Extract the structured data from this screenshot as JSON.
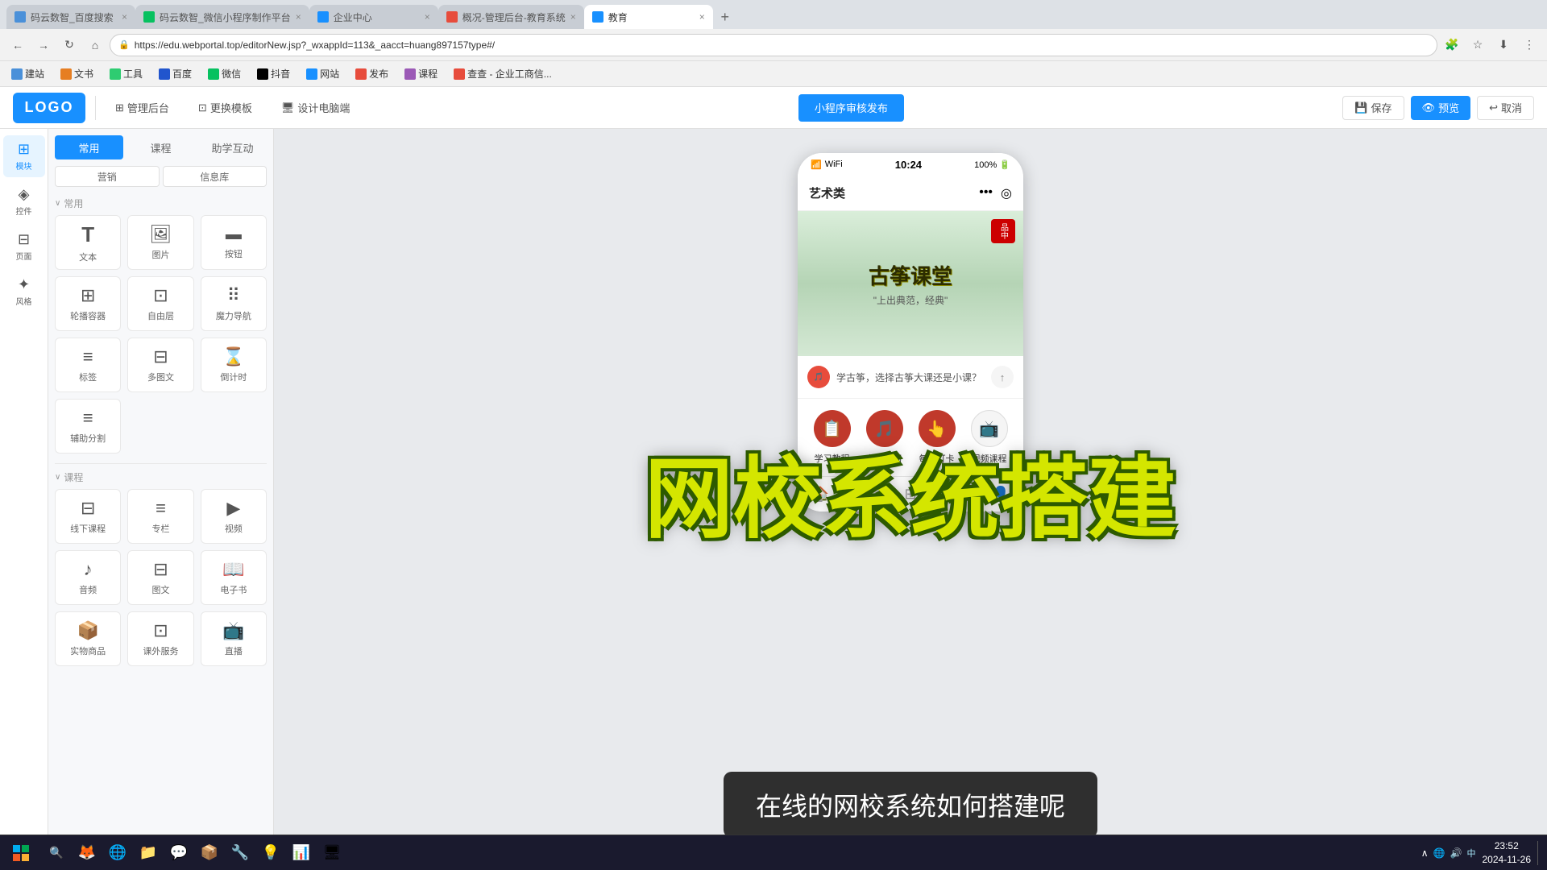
{
  "browser": {
    "tabs": [
      {
        "id": "t1",
        "label": "码云数智_百度搜索",
        "active": false,
        "favicon_color": "#4a90d9"
      },
      {
        "id": "t2",
        "label": "码云数智_微信小程序制作平台",
        "active": false,
        "favicon_color": "#07c160"
      },
      {
        "id": "t3",
        "label": "企业中心",
        "active": false,
        "favicon_color": "#1890ff"
      },
      {
        "id": "t4",
        "label": "概况-管理后台-教育系统",
        "active": false,
        "favicon_color": "#e74c3c"
      },
      {
        "id": "t5",
        "label": "教育",
        "active": true,
        "favicon_color": "#1890ff"
      }
    ],
    "address": "https://edu.webportal.top/editorNew.jsp?_wxappId=113&_aacct=huang897157type#/"
  },
  "bookmarks": [
    {
      "label": "建站",
      "icon_color": "#4a90d9"
    },
    {
      "label": "文书",
      "icon_color": "#e67e22"
    },
    {
      "label": "工具",
      "icon_color": "#2ecc71"
    },
    {
      "label": "百度",
      "icon_color": "#2155cd"
    },
    {
      "label": "微信",
      "icon_color": "#07c160"
    },
    {
      "label": "抖音",
      "icon_color": "#000"
    },
    {
      "label": "网站",
      "icon_color": "#1890ff"
    },
    {
      "label": "发布",
      "icon_color": "#e74c3c"
    },
    {
      "label": "课程",
      "icon_color": "#9b59b6"
    },
    {
      "label": "查查 - 企业工商信...",
      "icon_color": "#e74c3c"
    }
  ],
  "toolbar": {
    "logo": "LOGO",
    "management_label": "管理后台",
    "template_label": "更换模板",
    "design_label": "设计电脑端",
    "publish_label": "小程序审核发布",
    "save_label": "保存",
    "preview_label": "预览",
    "cancel_label": "取消"
  },
  "sidebar": {
    "items": [
      {
        "label": "模块",
        "icon": "⊞",
        "active": true
      },
      {
        "label": "控件",
        "icon": "◈",
        "active": false
      },
      {
        "label": "页面",
        "icon": "⊟",
        "active": false
      },
      {
        "label": "风格",
        "icon": "✦",
        "active": false
      }
    ]
  },
  "panel": {
    "tabs": [
      {
        "label": "常用",
        "active": true
      },
      {
        "label": "课程",
        "active": false
      },
      {
        "label": "助学互动",
        "active": false
      }
    ],
    "subtabs": [
      {
        "label": "营销",
        "active": false
      },
      {
        "label": "信息库",
        "active": false
      }
    ],
    "sections": [
      {
        "title": "常用",
        "items": [
          {
            "label": "文本",
            "icon": "T"
          },
          {
            "label": "图片",
            "icon": "🖼"
          },
          {
            "label": "按钮",
            "icon": "▬"
          },
          {
            "label": "轮播容器",
            "icon": "⊞"
          },
          {
            "label": "自由层",
            "icon": "⊡"
          },
          {
            "label": "魔力导航",
            "icon": "⠿"
          },
          {
            "label": "标签",
            "icon": "≡"
          },
          {
            "label": "多图文",
            "icon": "⊟"
          },
          {
            "label": "倒计时",
            "icon": "⌛"
          },
          {
            "label": "辅助分割",
            "icon": "≡"
          }
        ]
      },
      {
        "title": "课程",
        "items": [
          {
            "label": "线下课程",
            "icon": "⊟"
          },
          {
            "label": "专栏",
            "icon": "≡"
          },
          {
            "label": "视频",
            "icon": "▶"
          },
          {
            "label": "音频",
            "icon": "♪"
          },
          {
            "label": "图文",
            "icon": "⊟"
          },
          {
            "label": "电子书",
            "icon": "📖"
          },
          {
            "label": "实物商品",
            "icon": "📦"
          },
          {
            "label": "课外服务",
            "icon": "⊡"
          },
          {
            "label": "直播",
            "icon": "📺"
          }
        ]
      }
    ]
  },
  "phone": {
    "status_left": "📶 WiFi",
    "time": "10:24",
    "battery": "100% 🔋",
    "title": "艺术类",
    "banner_title": "古筝课堂",
    "banner_subtitle": "\"上出典范，经典\"",
    "seal_text": "品\n中",
    "chat_text": "学古筝，选择古筝大课还是小课？",
    "menu_items": [
      {
        "label": "学习教程",
        "icon": "📋",
        "color": "#c0392b"
      },
      {
        "label": "曲谱练习",
        "icon": "🎵",
        "color": "#c0392b"
      },
      {
        "label": "每日打卡",
        "icon": "👆",
        "color": "#c0392b"
      },
      {
        "label": "视频课程",
        "icon": "📺",
        "color": "#c0392b"
      }
    ],
    "bottom_nav": [
      {
        "label": "🏠",
        "active": true
      },
      {
        "label": "👤",
        "active": false
      },
      {
        "label": "⊞",
        "active": false
      },
      {
        "label": "📅",
        "active": false
      },
      {
        "label": "👤",
        "active": false
      }
    ]
  },
  "overlay": {
    "big_text": "网校系统搭建",
    "subtitle": "在线的网校系统如何搭建呢"
  },
  "taskbar": {
    "time": "23:52",
    "date": "2024-11-26",
    "apps": [
      "🪟",
      "🔍",
      "🦊",
      "🌐",
      "📁",
      "💬",
      "📦",
      "🔧",
      "💡",
      "🎮",
      "🗂"
    ]
  }
}
